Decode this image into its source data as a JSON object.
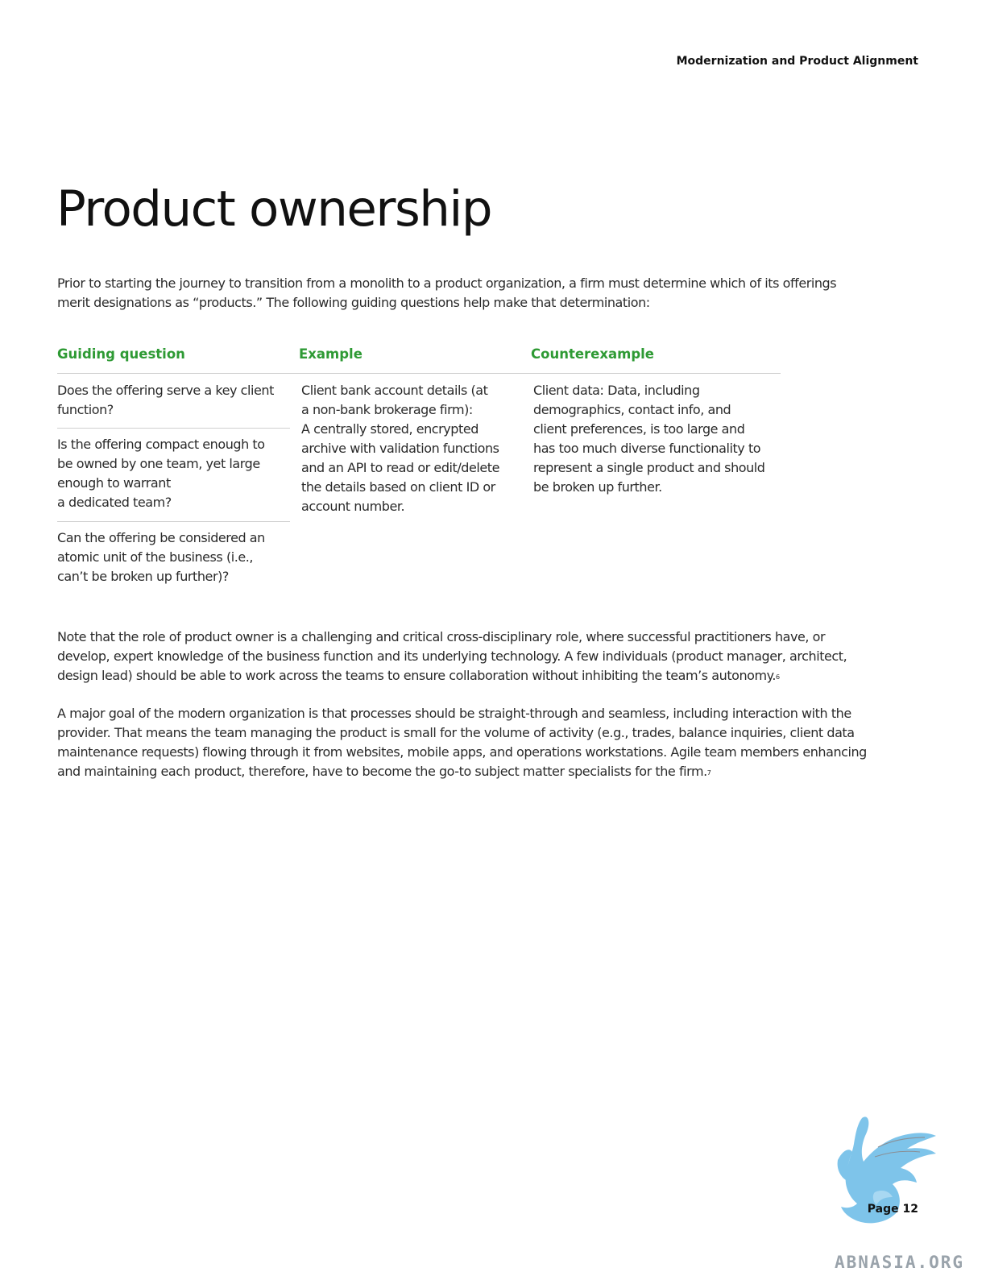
{
  "header": {
    "running_title": "Modernization and Product Alignment"
  },
  "title": "Product ownership",
  "intro": [
    "Prior to starting the journey to transition from a monolith to a product organization, a firm must determine which of its offerings",
    "merit designations as “products.” The following guiding questions help make that determination:"
  ],
  "table": {
    "headers": [
      "Guiding question",
      "Example",
      "Counterexample"
    ],
    "header_color": "#2e9a34",
    "questions": [
      [
        "Does the offering serve a key client",
        "function?"
      ],
      [
        "Is the offering compact enough to",
        "be owned by one team, yet large",
        "enough to warrant",
        "a dedicated team?"
      ],
      [
        "Can the offering be considered an",
        "atomic unit of the business (i.e.,",
        "can’t be broken up further)?"
      ]
    ],
    "example": [
      "Client bank account details (at",
      "a non-bank brokerage firm):",
      "A centrally stored, encrypted",
      "archive with validation functions",
      "and an API to read or edit/delete",
      "the details based on client ID or",
      "account number."
    ],
    "counterexample": [
      "Client data: Data, including",
      "demographics, contact info, and",
      "client preferences, is too large and",
      "has too much diverse functionality to",
      "represent a single product and should",
      "be broken up further."
    ]
  },
  "note": {
    "lines": [
      "Note that the role of product owner is a challenging and critical cross-disciplinary role, where successful practitioners have, or",
      "develop, expert knowledge of the business function and its underlying technology. A few individuals (product manager, architect,",
      "design lead) should be able to work across the teams to ensure collaboration without inhibiting the team’s autonomy."
    ],
    "footnote": "6"
  },
  "goal": {
    "lines": [
      "A major goal of the modern organization is that processes should be straight-through and seamless, including interaction with the",
      "provider. That means the team managing the product is small for the volume of activity (e.g., trades, balance inquiries, client data",
      "maintenance requests) flowing through it from websites, mobile apps, and operations workstations. Agile team members enhancing",
      "and maintaining each product, therefore, have to become the go-to subject matter specialists for the firm."
    ],
    "footnote": "7"
  },
  "footer": {
    "page_label": "Page 12",
    "watermark": "ABNASIA.ORG"
  },
  "logo": {
    "icon": "griffin-logo-icon",
    "color": "#7ec4ea"
  }
}
